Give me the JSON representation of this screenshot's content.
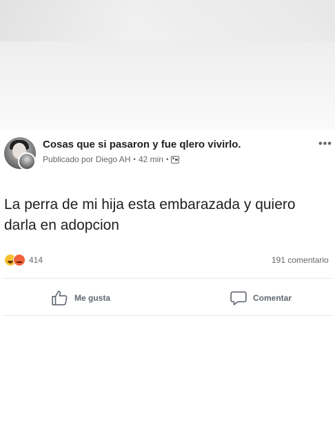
{
  "post": {
    "group_name": "Cosas que si pasaron y fue qlero vivirlo.",
    "published_by": "Publicado por Diego AH",
    "time": "42 min",
    "text": "La perra de mi hija esta embarazada y quiero darla en adopcion",
    "reaction_count": "414",
    "comments_count": "191 comentario",
    "reactions": [
      "haha",
      "angry"
    ]
  },
  "actions": {
    "like_label": "Me gusta",
    "comment_label": "Comentar"
  },
  "icons": {
    "more": "more-options-icon",
    "audience": "audience-icon",
    "like": "thumbs-up-icon",
    "comment": "comment-bubble-icon"
  }
}
